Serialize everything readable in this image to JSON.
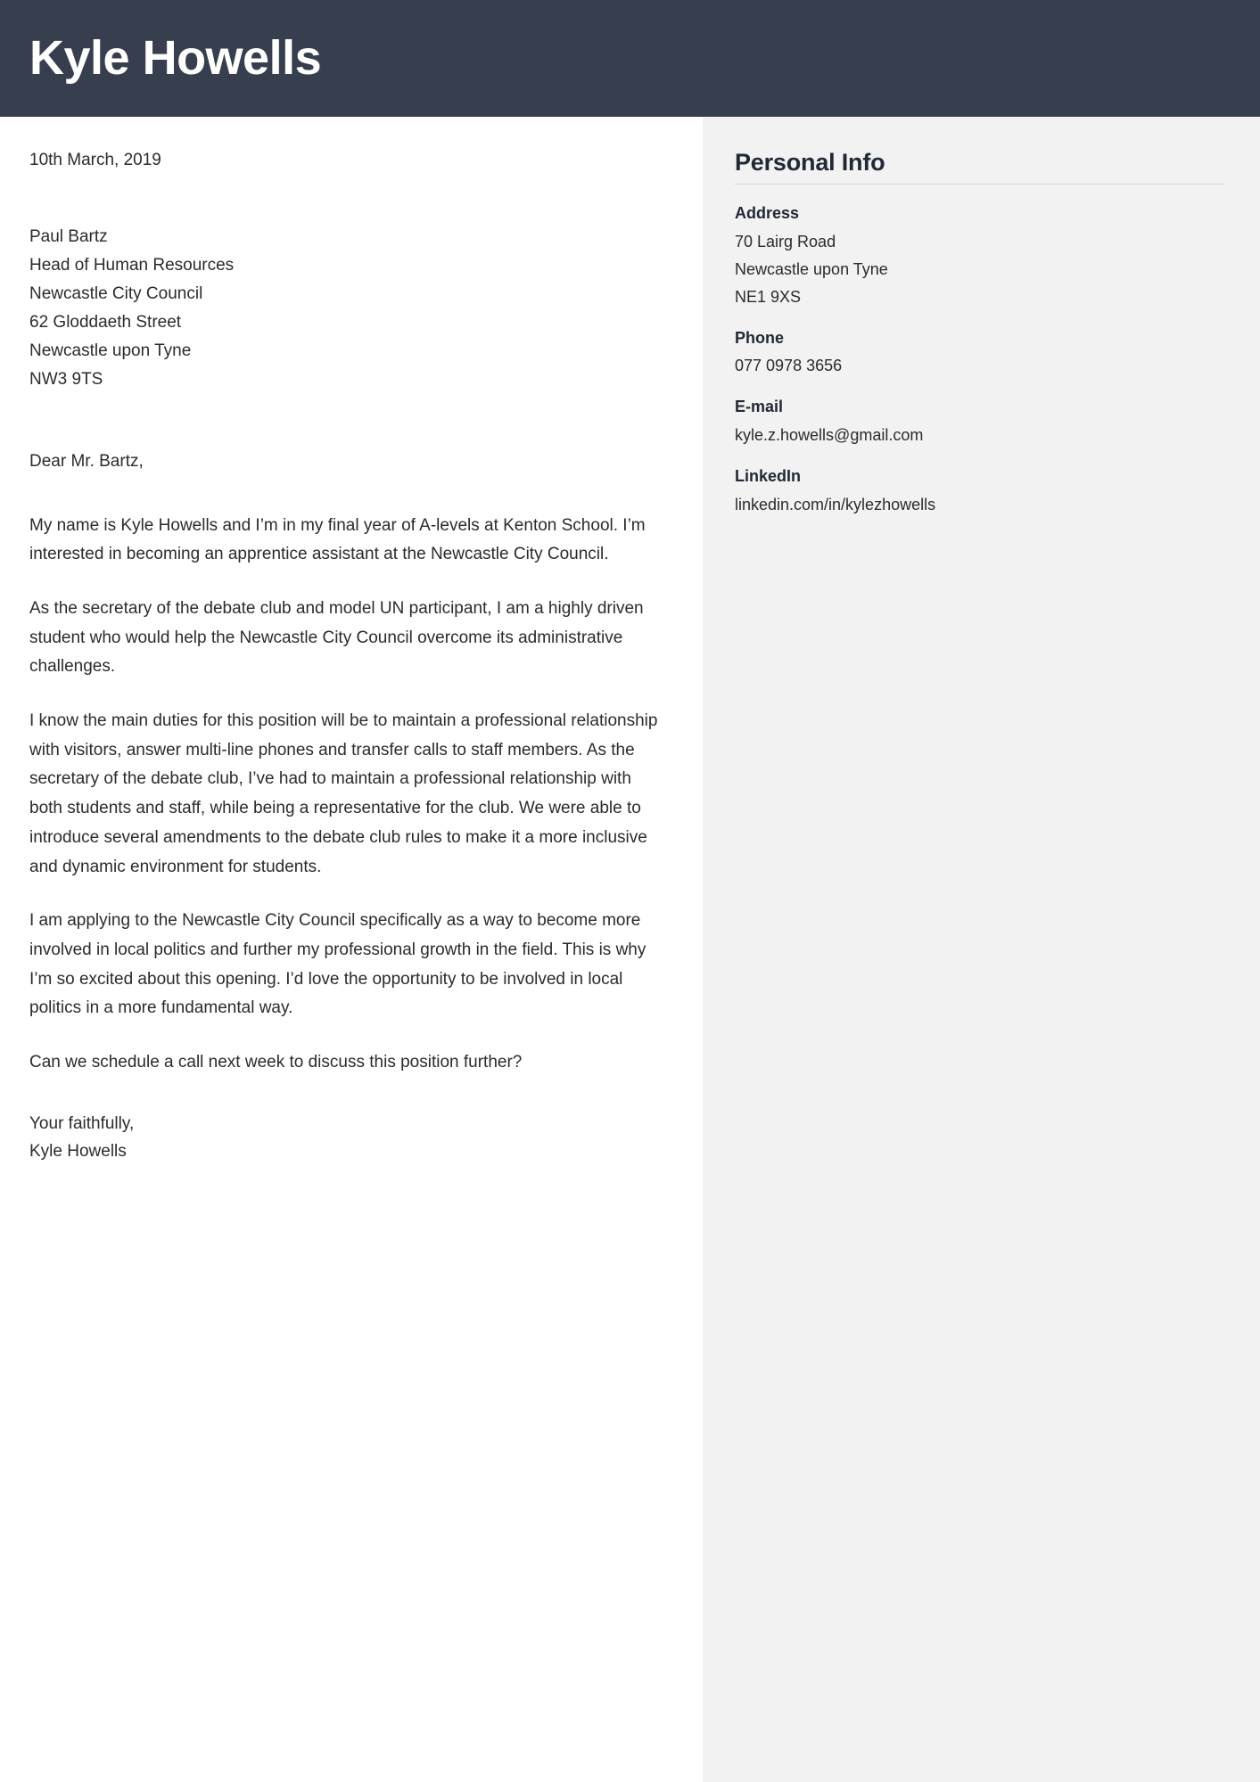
{
  "document": {
    "type": "cover-letter",
    "header_bg": "#373f4e",
    "sidebar_bg": "#f2f2f2",
    "text_color": "#2b2b2b"
  },
  "header": {
    "name": "Kyle Howells"
  },
  "letter": {
    "date": "10th March, 2019",
    "recipient": [
      "Paul Bartz",
      "Head of Human Resources",
      "Newcastle City Council",
      "62 Gloddaeth Street",
      "Newcastle upon Tyne",
      "NW3 9TS"
    ],
    "salutation": "Dear Mr. Bartz,",
    "paragraphs": [
      "My name is Kyle Howells and I’m in my final year of A-levels at Kenton School. I’m interested in becoming an apprentice assistant at the Newcastle City Council.",
      "As the secretary of the debate club and model UN participant, I am a highly driven student who would help the Newcastle City Council overcome its administrative challenges.",
      "I know the main duties for this position will be to maintain a professional relationship with visitors, answer multi-line phones and transfer calls to staff members. As the secretary of the debate club, I’ve had to maintain a professional relationship with both students and staff, while being a representative for the club. We were able to introduce several amendments to the debate club rules to make it a more inclusive and dynamic environment for students.",
      "I am applying to the Newcastle City Council specifically as a way to become more involved in local politics and further my professional growth in the field. This is why I’m so excited about this opening. I’d love the opportunity to be involved in local politics in a more fundamental way.",
      "Can we schedule a call next week to discuss this position further?"
    ],
    "closing": "Your faithfully,",
    "signature": "Kyle Howells"
  },
  "sidebar": {
    "title": "Personal Info",
    "groups": [
      {
        "label": "Address",
        "values": [
          "70 Lairg Road",
          "Newcastle upon Tyne",
          "NE1 9XS"
        ]
      },
      {
        "label": "Phone",
        "values": [
          "077 0978 3656"
        ]
      },
      {
        "label": "E-mail",
        "values": [
          "kyle.z.howells@gmail.com"
        ]
      },
      {
        "label": "LinkedIn",
        "values": [
          "linkedin.com/in/kylezhowells"
        ]
      }
    ]
  }
}
